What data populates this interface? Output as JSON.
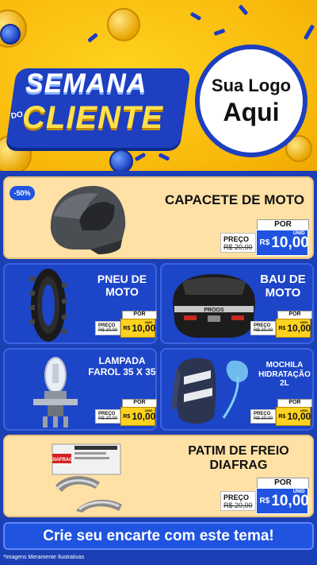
{
  "header": {
    "title_line1": "SEMANA",
    "title_do": "DO",
    "title_line2": "CLIENTE",
    "logo_line1": "Sua Logo",
    "logo_line2": "Aqui"
  },
  "products": [
    {
      "name": "CAPACETE DE MOTO",
      "badge": "-50%",
      "preco_label": "PREÇO",
      "old": "R$ 20,00",
      "por": "POR",
      "cur": "R$",
      "price": "10,00",
      "unid": "UNID"
    },
    {
      "name": "PNEU DE MOTO",
      "preco_label": "PREÇO",
      "old": "R$ 20,00",
      "por": "POR",
      "cur": "R$",
      "price": "10,00",
      "unid": "UNID"
    },
    {
      "name": "BAU DE MOTO",
      "preco_label": "PREÇO",
      "old": "R$ 20,00",
      "por": "POR",
      "cur": "R$",
      "price": "10,00",
      "unid": "UNID"
    },
    {
      "name": "LAMPADA FAROL 35 X 35",
      "preco_label": "PREÇO",
      "old": "R$ 20,00",
      "por": "POR",
      "cur": "R$",
      "price": "10,00",
      "unid": "UNID"
    },
    {
      "name": "MOCHILA HIDRATAÇÃO 2L",
      "preco_label": "PREÇO",
      "old": "R$ 20,00",
      "por": "POR",
      "cur": "R$",
      "price": "10,00",
      "unid": "UNID"
    },
    {
      "name": "PATIM DE FREIO DIAFRAG",
      "preco_label": "PREÇO",
      "old": "R$ 20,00",
      "por": "POR",
      "cur": "R$",
      "price": "10,00",
      "unid": "UNID",
      "brand": "DIAFRAG"
    }
  ],
  "cta": "Crie seu encarte com este tema!",
  "footer": "*Imagens Meramente Ilustrativas",
  "colors": {
    "yellow": "#ffd21f",
    "blue": "#1d45c8",
    "cream": "#ffe1a6"
  }
}
